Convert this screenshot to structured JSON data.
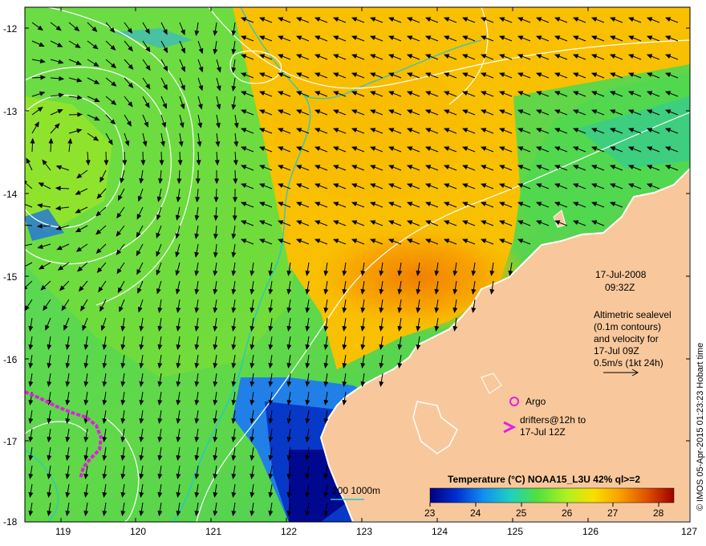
{
  "colors": {
    "land": "#f8c89c",
    "coastline": "#ffffff",
    "bathymetry_200": "#20c8d0",
    "sealevel_contour": "#ffffff",
    "arrows": "#000000",
    "argo": "#e020e0",
    "drifter": "#e020e0"
  },
  "map": {
    "lon_ticks": [
      "119",
      "120",
      "121",
      "122",
      "123",
      "124",
      "125",
      "126",
      "127"
    ],
    "lat_ticks": [
      "-12",
      "-13",
      "-14",
      "-15",
      "-16",
      "-17",
      "-18"
    ],
    "lon_range": [
      118.6,
      127.0
    ],
    "lat_range": [
      -18.0,
      -11.8
    ]
  },
  "annotations": {
    "date": "17-Jul-2008",
    "time": "09:32Z",
    "alt_line1": "Altimetric sealevel",
    "alt_line2": "(0.1m contours)",
    "alt_line3": "and velocity for",
    "alt_line4": "17-Jul 09Z",
    "alt_line5": "0.5m/s (1kt 24h)",
    "argo_label": "Argo",
    "drifters_line1": "drifters@12h to",
    "drifters_line2": "17-Jul 12Z",
    "bathy_label": "200  1000m"
  },
  "colorbar": {
    "title": "Temperature (°C) NOAA15_L3U 42% ql>=2",
    "ticks": [
      "23",
      "24",
      "25",
      "26",
      "27",
      "28"
    ],
    "range": [
      23,
      28.8
    ],
    "stops": [
      "#000080",
      "#0030d0",
      "#1090f0",
      "#20d0c0",
      "#50e040",
      "#b0f020",
      "#f8e000",
      "#f8a000",
      "#e05000",
      "#a00000"
    ]
  },
  "credit": "© IMOS 05-Apr-2015 01:23:23 Hobart time"
}
